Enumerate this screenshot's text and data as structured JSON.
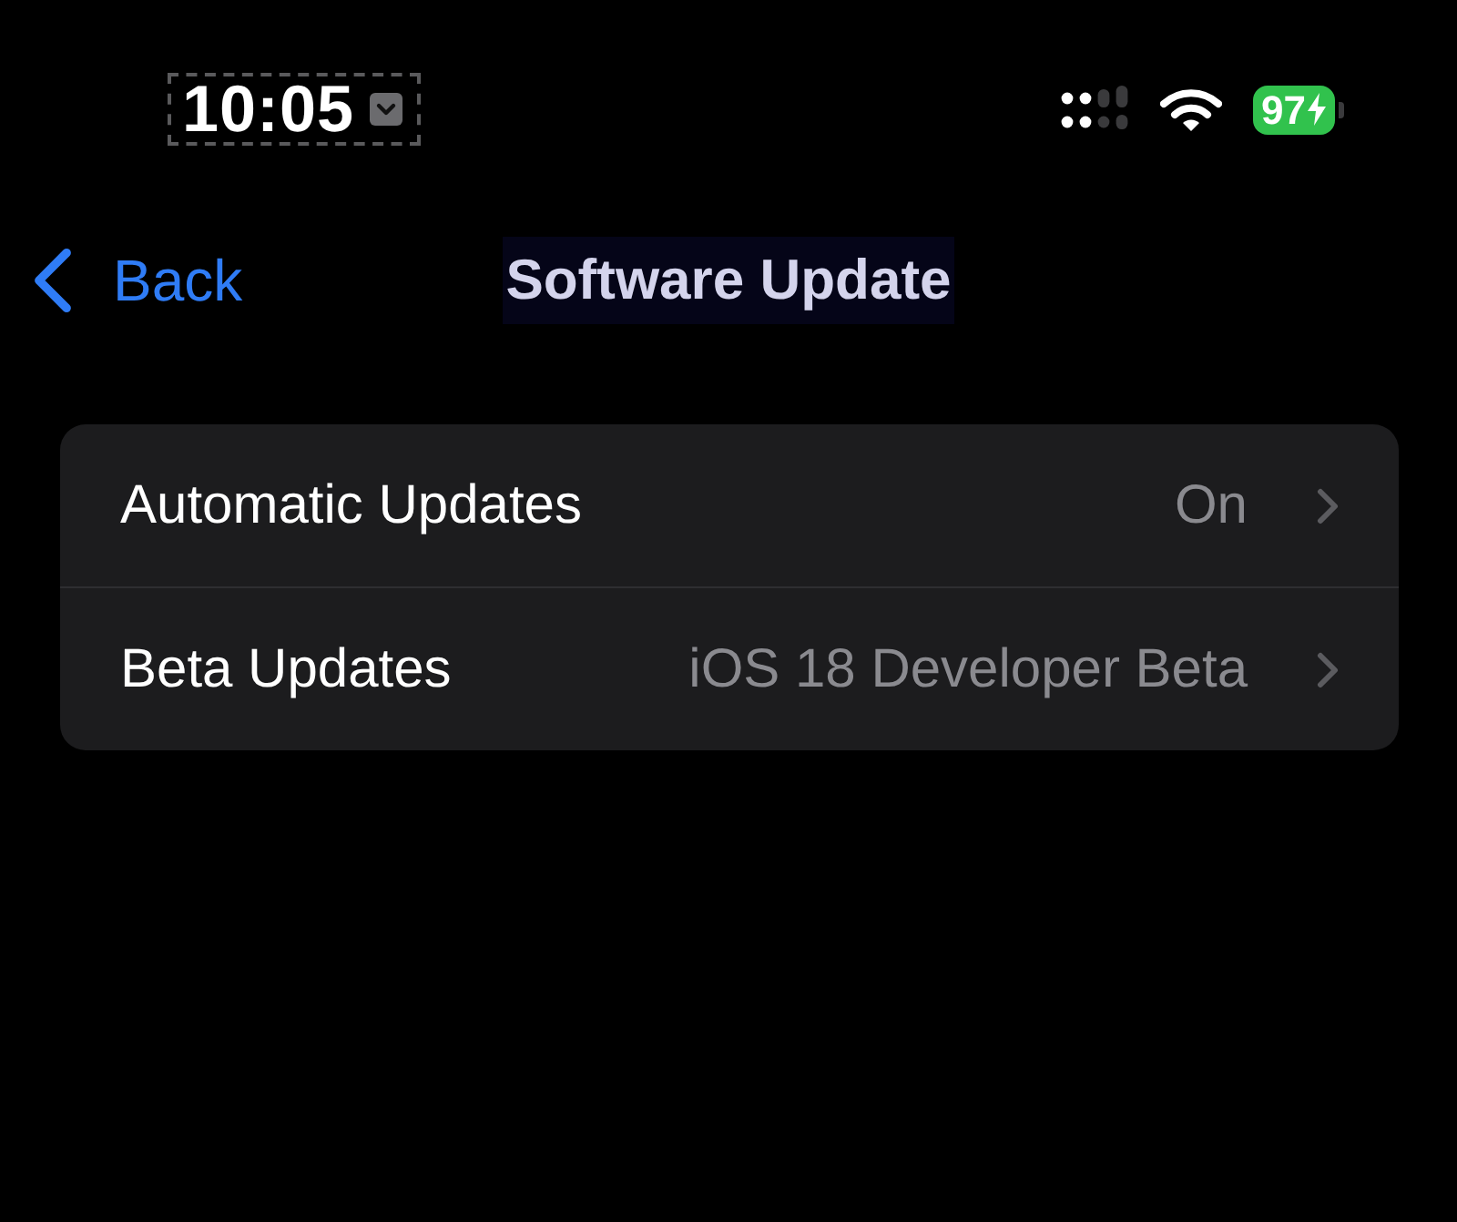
{
  "status_bar": {
    "time": "10:05",
    "time_focused": true,
    "battery": {
      "percent": "97",
      "charging": true
    }
  },
  "nav_bar": {
    "back": "Back",
    "title": "Software Update",
    "title_highlighted": true
  },
  "settings": [
    {
      "label": "Automatic Updates",
      "value": "On"
    },
    {
      "label": "Beta Updates",
      "value": "iOS 18 Developer Beta"
    }
  ]
}
